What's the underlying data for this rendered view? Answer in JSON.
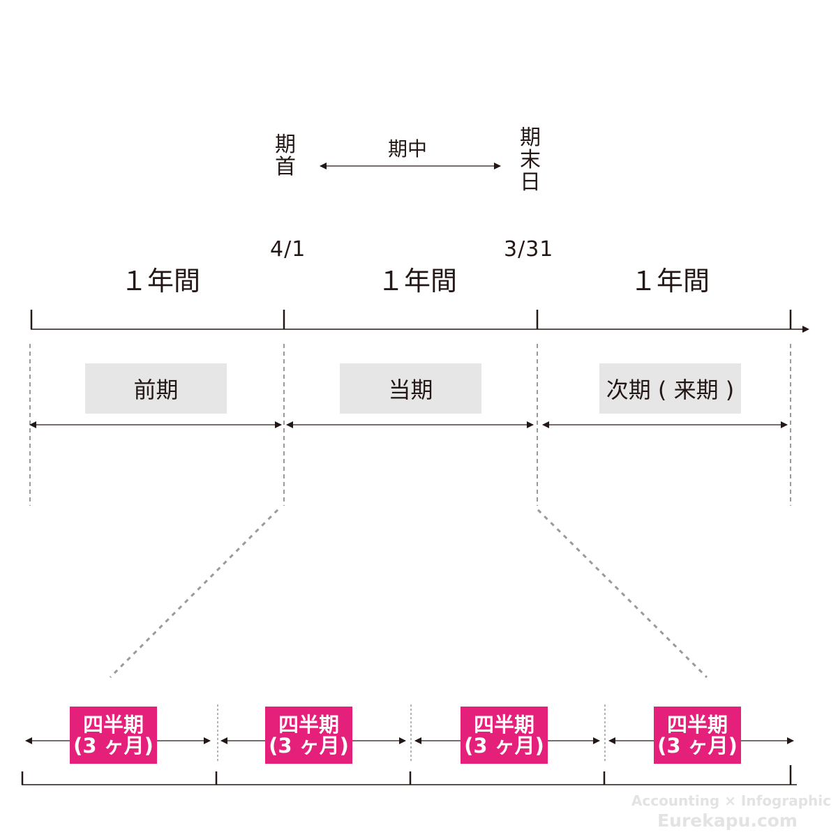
{
  "legend": {
    "start_label_chars": [
      "期",
      "首"
    ],
    "middle_label": "期中",
    "end_label_chars": [
      "期",
      "末",
      "日"
    ]
  },
  "dates": {
    "start": "4/1",
    "end": "3/31"
  },
  "timeline": {
    "year_labels": [
      "１年間",
      "１年間",
      "１年間"
    ],
    "periods": [
      {
        "label": "前期"
      },
      {
        "label": "当期"
      },
      {
        "label": "次期 ( 来期 )"
      }
    ]
  },
  "quarters": {
    "count": 4,
    "items": [
      {
        "line1": "四半期",
        "line2": "(3 ヶ月)"
      },
      {
        "line1": "四半期",
        "line2": "(3 ヶ月)"
      },
      {
        "line1": "四半期",
        "line2": "(3 ヶ月)"
      },
      {
        "line1": "四半期",
        "line2": "(3 ヶ月)"
      }
    ]
  },
  "colors": {
    "ink": "#231815",
    "guide": "#9a9a9a",
    "period_fill": "#e6e6e6",
    "quarter_fill": "#e4207a",
    "watermark": "#e3e3e3"
  },
  "watermark": {
    "line1": "Accounting × Infographic",
    "line2": "Eurekapu.com"
  }
}
